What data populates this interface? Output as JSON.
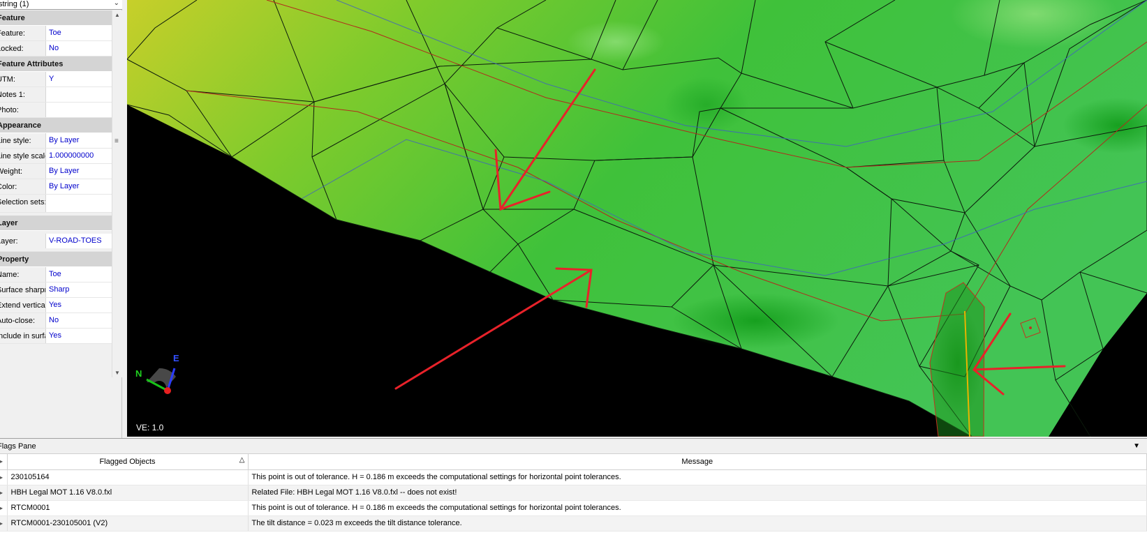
{
  "properties_panel": {
    "selector": "string (1)",
    "categories": [
      {
        "title": "Feature",
        "rows": [
          {
            "key": "Feature:",
            "value": "Toe"
          },
          {
            "key": "Locked:",
            "value": "No"
          }
        ]
      },
      {
        "title": "Feature Attributes",
        "rows": [
          {
            "key": "UTM:",
            "value": "Y"
          },
          {
            "key": "Notes 1:",
            "value": ""
          },
          {
            "key": "Photo:",
            "value": ""
          }
        ]
      },
      {
        "title": "Appearance",
        "rows": [
          {
            "key": "Line style:",
            "value": "By Layer"
          },
          {
            "key": "Line style scale:",
            "value": "1.000000000"
          },
          {
            "key": "Weight:",
            "value": "By Layer"
          },
          {
            "key": "Color:",
            "value": "By Layer"
          },
          {
            "key": "Selection sets:",
            "value": ""
          }
        ]
      },
      {
        "title": "Layer",
        "rows": [
          {
            "key": "Layer:",
            "value": "V-ROAD-TOES"
          }
        ]
      },
      {
        "title": "Property",
        "rows": [
          {
            "key": "Name:",
            "value": "Toe"
          },
          {
            "key": "Surface sharpn",
            "value": "Sharp"
          },
          {
            "key": "Extend vertical:",
            "value": "Yes"
          },
          {
            "key": "Auto-close:",
            "value": "No"
          },
          {
            "key": "Include in surfa",
            "value": "Yes"
          }
        ]
      }
    ]
  },
  "viewport": {
    "ve_label": "VE: 1.0",
    "compass": {
      "north": "N",
      "east": "E"
    }
  },
  "flags_pane": {
    "title": "Flags Pane",
    "columns": [
      "Flagged Objects",
      "Message"
    ],
    "rows": [
      {
        "object": "230105164",
        "message": "This point is out of tolerance. H = 0.186 m exceeds the computational settings for horizontal point tolerances."
      },
      {
        "object": "HBH Legal MOT 1.16 V8.0.fxl",
        "message": "Related File: HBH Legal MOT 1.16 V8.0.fxl -- does not exist!"
      },
      {
        "object": "RTCM0001",
        "message": "This point is out of tolerance. H = 0.186 m exceeds the computational settings for horizontal point tolerances."
      },
      {
        "object": "RTCM0001-230105001 (V2)",
        "message": "The tilt distance = 0.023 m exceeds the tilt distance tolerance."
      }
    ]
  },
  "colors": {
    "terrain_light": "#b8d12a",
    "terrain_mid": "#5fc832",
    "terrain_dark": "#1f9e1f",
    "arrow": "#e8222a",
    "breakline": "#c0392b",
    "blue_line": "#4a6fd0"
  }
}
